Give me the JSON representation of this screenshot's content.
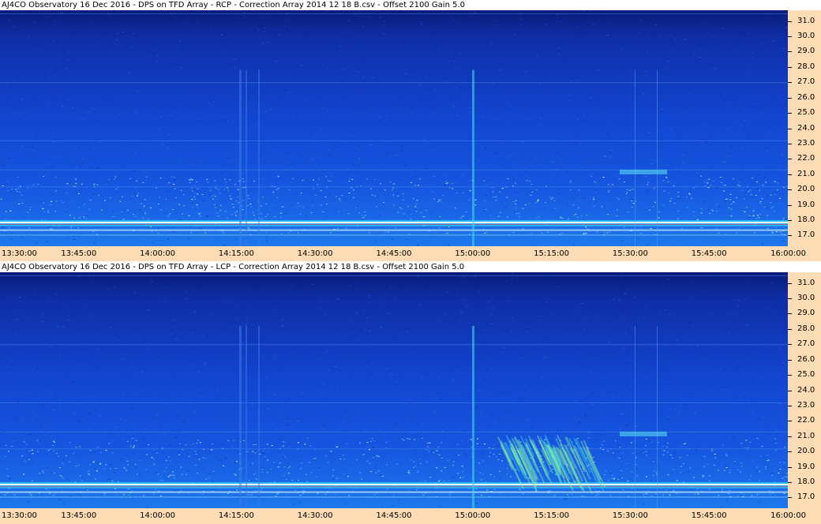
{
  "chart_data": [
    {
      "type": "heatmap",
      "title": "AJ4CO Observatory 16 Dec 2016  -  DPS on TFD Array  -  RCP  -  Correction Array 2014 12 18 B.csv  -  Offset 2100  Gain 5.0",
      "polarization": "RCP",
      "xlabel": "",
      "ylabel": "",
      "x_ticks": [
        "13:30:00",
        "13:45:00",
        "14:00:00",
        "14:15:00",
        "14:30:00",
        "14:45:00",
        "15:00:00",
        "15:15:00",
        "15:30:00",
        "15:45:00",
        "16:00:00"
      ],
      "y_ticks": [
        "31.0",
        "30.0",
        "29.0",
        "28.0",
        "27.0",
        "26.0",
        "25.0",
        "24.0",
        "23.0",
        "22.0",
        "21.0",
        "20.0",
        "19.0",
        "18.0",
        "17.0"
      ],
      "xlim": [
        "13:30:00",
        "16:00:00"
      ],
      "ylim": [
        16.3,
        31.7
      ],
      "colorscale": "blue (low) to cyan/green/yellow/red (high)"
    },
    {
      "type": "heatmap",
      "title": "AJ4CO Observatory 16 Dec 2016  -  DPS on TFD Array  -  LCP  -  Correction Array 2014 12 18 B.csv  -  Offset 2100  Gain 5.0",
      "polarization": "LCP",
      "xlabel": "",
      "ylabel": "",
      "x_ticks": [
        "13:30:00",
        "13:45:00",
        "14:00:00",
        "14:15:00",
        "14:30:00",
        "14:45:00",
        "15:00:00",
        "15:15:00",
        "15:30:00",
        "15:45:00",
        "16:00:00"
      ],
      "y_ticks": [
        "31.0",
        "30.0",
        "29.0",
        "28.0",
        "27.0",
        "26.0",
        "25.0",
        "24.0",
        "23.0",
        "22.0",
        "21.0",
        "20.0",
        "19.0",
        "18.0",
        "17.0"
      ],
      "xlim": [
        "13:30:00",
        "16:00:00"
      ],
      "ylim": [
        16.3,
        31.7
      ],
      "colorscale": "blue (low) to cyan/green/yellow/red (high)"
    }
  ]
}
